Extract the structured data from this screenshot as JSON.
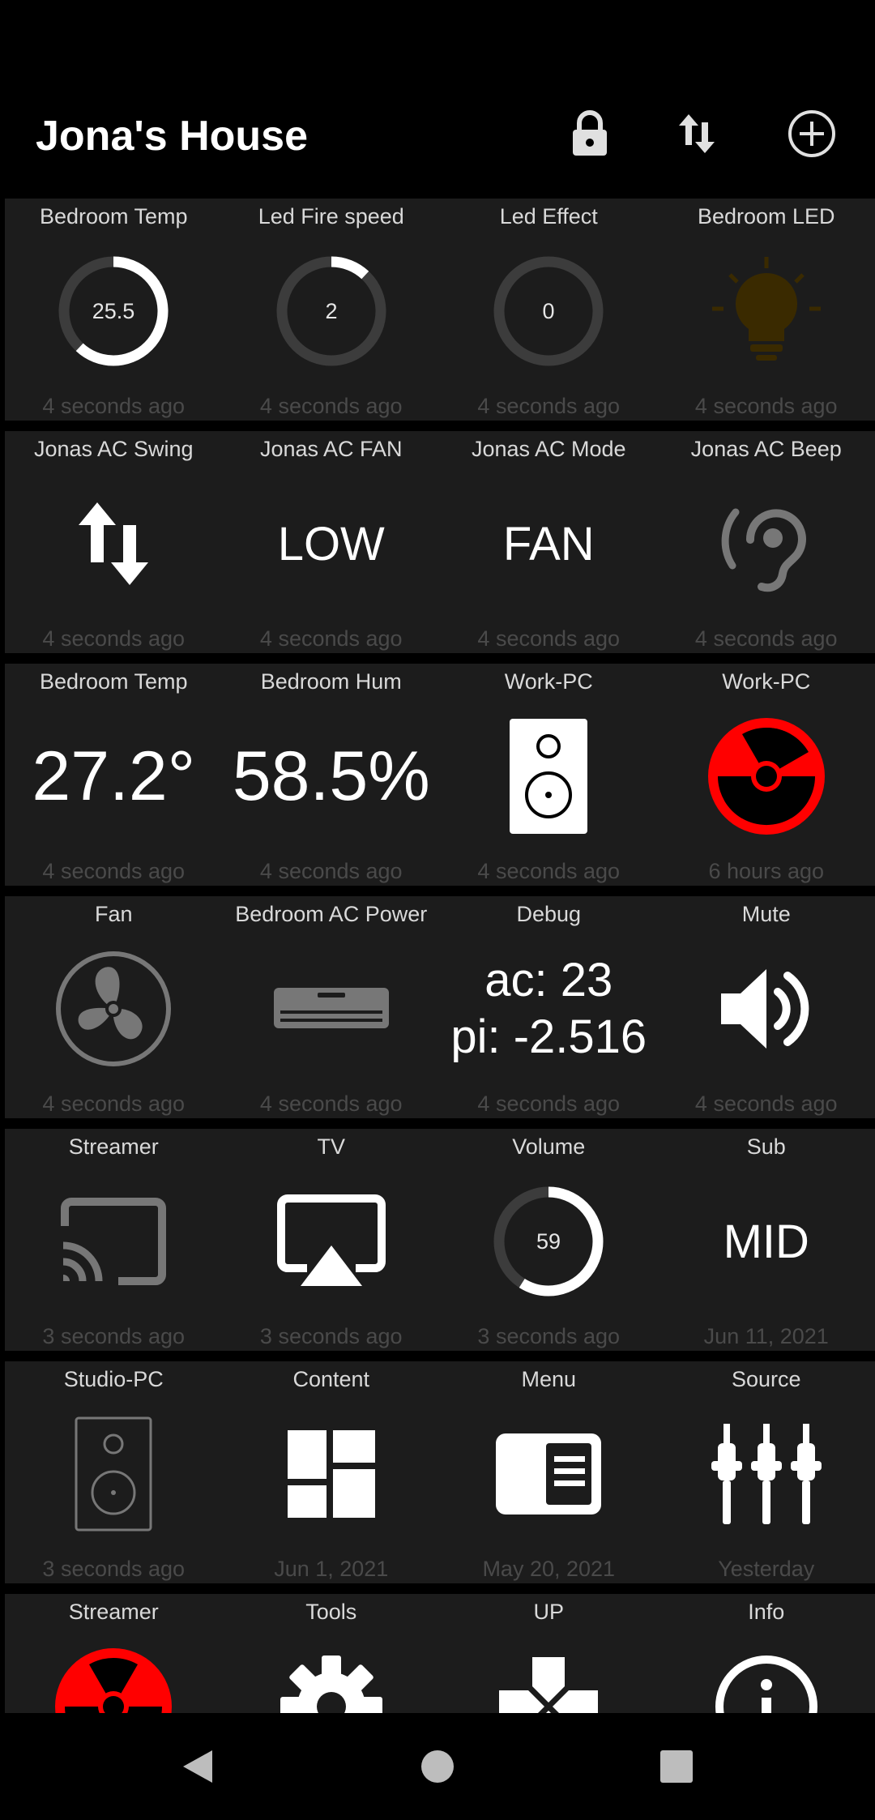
{
  "app": {
    "title": "Jona's House"
  },
  "rows": [
    [
      {
        "label": "Bedroom Temp",
        "value": "25.5",
        "time": "4 seconds ago",
        "gauge_fraction": 0.62
      },
      {
        "label": "Led Fire speed",
        "value": "2",
        "time": "4 seconds ago",
        "gauge_fraction": 0.12
      },
      {
        "label": "Led Effect",
        "value": "0",
        "time": "4 seconds ago",
        "gauge_fraction": 0
      },
      {
        "label": "Bedroom LED",
        "time": "4 seconds ago",
        "icon": "lightbulb-icon"
      }
    ],
    [
      {
        "label": "Jonas AC Swing",
        "time": "4 seconds ago",
        "icon": "swap-vertical-icon"
      },
      {
        "label": "Jonas AC FAN",
        "value": "LOW",
        "time": "4 seconds ago"
      },
      {
        "label": "Jonas AC Mode",
        "value": "FAN",
        "time": "4 seconds ago"
      },
      {
        "label": "Jonas AC Beep",
        "time": "4 seconds ago",
        "icon": "ear-icon"
      }
    ],
    [
      {
        "label": "Bedroom Temp",
        "value": "27.2°",
        "time": "4 seconds ago"
      },
      {
        "label": "Bedroom Hum",
        "value": "58.5%",
        "time": "4 seconds ago"
      },
      {
        "label": "Work-PC",
        "time": "4 seconds ago",
        "icon": "speaker-icon"
      },
      {
        "label": "Work-PC",
        "time": "6 hours ago",
        "icon": "radiation-icon"
      }
    ],
    [
      {
        "label": "Fan",
        "time": "4 seconds ago",
        "icon": "fan-icon"
      },
      {
        "label": "Bedroom AC Power",
        "time": "4 seconds ago",
        "icon": "air-conditioner-icon"
      },
      {
        "label": "Debug",
        "line1": "ac: 23",
        "line2": "pi: -2.516",
        "time": "4 seconds ago"
      },
      {
        "label": "Mute",
        "time": "4 seconds ago",
        "icon": "volume-icon"
      }
    ],
    [
      {
        "label": "Streamer",
        "time": "3 seconds ago",
        "icon": "cast-icon"
      },
      {
        "label": "TV",
        "time": "3 seconds ago",
        "icon": "airplay-icon"
      },
      {
        "label": "Volume",
        "value": "59",
        "time": "3 seconds ago",
        "gauge_fraction": 0.59
      },
      {
        "label": "Sub",
        "value": "MID",
        "time": "Jun 11, 2021"
      }
    ],
    [
      {
        "label": "Studio-PC",
        "time": "3 seconds ago",
        "icon": "speaker-outline-icon"
      },
      {
        "label": "Content",
        "time": "Jun 1, 2021",
        "icon": "dashboard-icon"
      },
      {
        "label": "Menu",
        "time": "May 20, 2021",
        "icon": "menu-panel-icon"
      },
      {
        "label": "Source",
        "time": "Yesterday",
        "icon": "rca-plugs-icon"
      }
    ],
    [
      {
        "label": "Streamer",
        "icon": "radiation-icon"
      },
      {
        "label": "Tools",
        "icon": "gear-icon"
      },
      {
        "label": "UP",
        "icon": "dpad-up-icon"
      },
      {
        "label": "Info",
        "icon": "info-icon"
      }
    ]
  ],
  "colors": {
    "background": "#000000",
    "tile": "#1c1c1c",
    "accent_red": "#ff0000",
    "bulb_off": "#3a2a00"
  }
}
